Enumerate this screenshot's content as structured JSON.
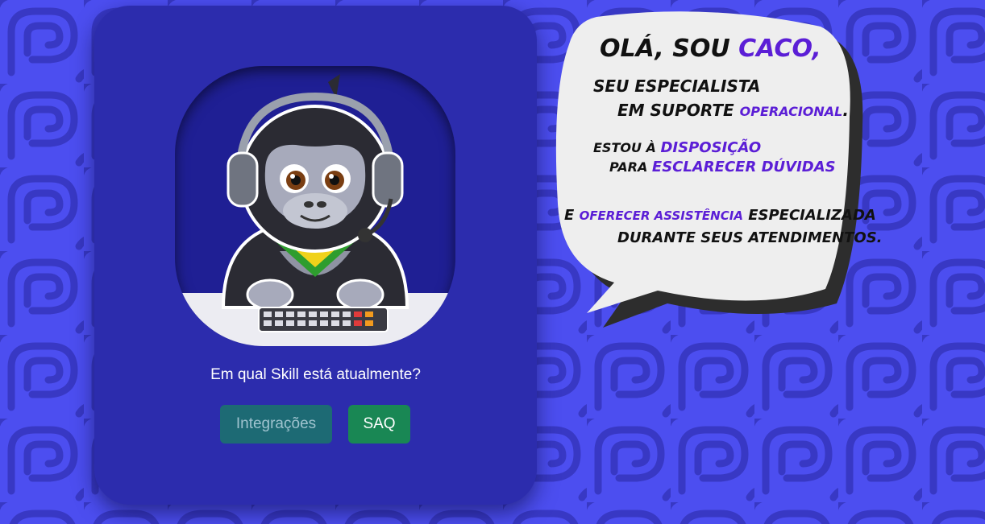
{
  "card": {
    "question": "Em qual Skill está atualmente?",
    "buttons": [
      {
        "label": "Integrações"
      },
      {
        "label": "SAQ"
      }
    ]
  },
  "speech": {
    "line1": {
      "a": "Olá, sou ",
      "b": "Caco,"
    },
    "line2": "Seu especialista",
    "line3": {
      "a": "em suporte ",
      "b": "operacional",
      "c": "."
    },
    "line4": {
      "a": "Estou à ",
      "b": "disposição"
    },
    "line5": {
      "a": "para ",
      "b": "esclarecer dúvidas"
    },
    "line6": {
      "a": "e ",
      "b": "oferecer assistência",
      "c": " especializada"
    },
    "line7": "durante seus atendimentos."
  },
  "colors": {
    "background": "#4c4ef0",
    "card": "#2c2cad",
    "accent": "#5b1ed6",
    "button_integracoes": "#1d6a74",
    "button_saq": "#198754"
  },
  "icons": [
    "gorilla-mascot-with-headset",
    "speech-bubble"
  ]
}
